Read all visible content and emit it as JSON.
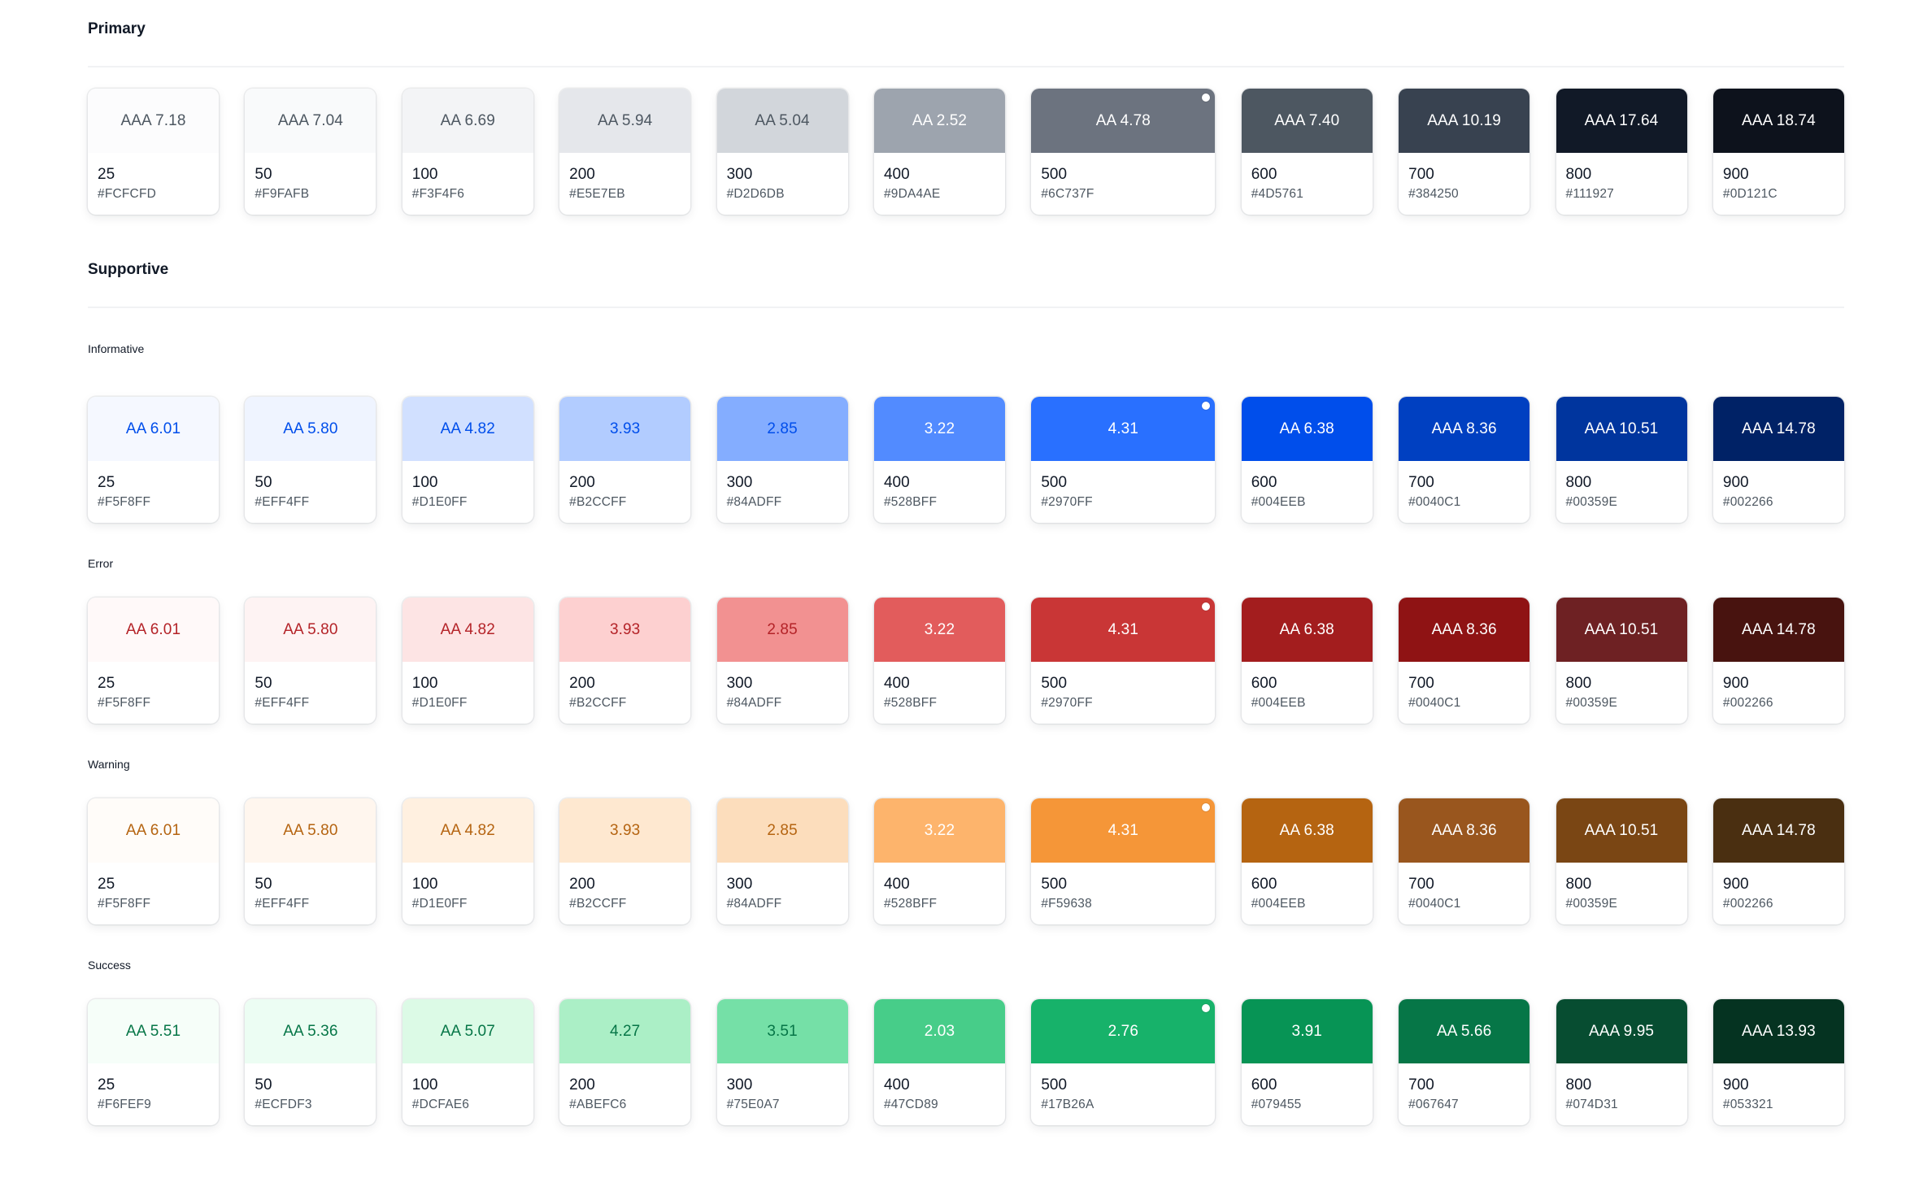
{
  "sections": {
    "primary": {
      "title": "Primary",
      "swatches": [
        {
          "step": "25",
          "hex": "#FCFCFD",
          "label": "AAA 7.18",
          "bg": "#FCFCFD",
          "fg": "#4D5761"
        },
        {
          "step": "50",
          "hex": "#F9FAFB",
          "label": "AAA 7.04",
          "bg": "#F9FAFB",
          "fg": "#4D5761"
        },
        {
          "step": "100",
          "hex": "#F3F4F6",
          "label": "AA 6.69",
          "bg": "#F3F4F6",
          "fg": "#4D5761"
        },
        {
          "step": "200",
          "hex": "#E5E7EB",
          "label": "AA 5.94",
          "bg": "#E5E7EB",
          "fg": "#4D5761"
        },
        {
          "step": "300",
          "hex": "#D2D6DB",
          "label": "AA 5.04",
          "bg": "#D2D6DB",
          "fg": "#4D5761"
        },
        {
          "step": "400",
          "hex": "#9DA4AE",
          "label": "AA 2.52",
          "bg": "#9DA4AE",
          "fg": "#FFFFFF"
        },
        {
          "step": "500",
          "hex": "#6C737F",
          "label": "AA 4.78",
          "bg": "#6C737F",
          "fg": "#FFFFFF",
          "selected": true
        },
        {
          "step": "600",
          "hex": "#4D5761",
          "label": "AAA 7.40",
          "bg": "#4D5761",
          "fg": "#FFFFFF"
        },
        {
          "step": "700",
          "hex": "#384250",
          "label": "AAA 10.19",
          "bg": "#384250",
          "fg": "#FFFFFF"
        },
        {
          "step": "800",
          "hex": "#111927",
          "label": "AAA 17.64",
          "bg": "#111927",
          "fg": "#FFFFFF"
        },
        {
          "step": "900",
          "hex": "#0D121C",
          "label": "AAA 18.74",
          "bg": "#0D121C",
          "fg": "#FFFFFF"
        }
      ]
    },
    "supportive": {
      "title": "Supportive",
      "groups": {
        "informative": {
          "label": "Informative",
          "swatches": [
            {
              "step": "25",
              "hex": "#F5F8FF",
              "label": "AA 6.01",
              "bg": "#F5F8FF",
              "fg": "#004EEB"
            },
            {
              "step": "50",
              "hex": "#EFF4FF",
              "label": "AA 5.80",
              "bg": "#EFF4FF",
              "fg": "#004EEB"
            },
            {
              "step": "100",
              "hex": "#D1E0FF",
              "label": "AA 4.82",
              "bg": "#D1E0FF",
              "fg": "#004EEB"
            },
            {
              "step": "200",
              "hex": "#B2CCFF",
              "label": "3.93",
              "bg": "#B2CCFF",
              "fg": "#004EEB"
            },
            {
              "step": "300",
              "hex": "#84ADFF",
              "label": "2.85",
              "bg": "#84ADFF",
              "fg": "#004EEB"
            },
            {
              "step": "400",
              "hex": "#528BFF",
              "label": "3.22",
              "bg": "#528BFF",
              "fg": "#FFFFFF"
            },
            {
              "step": "500",
              "hex": "#2970FF",
              "label": "4.31",
              "bg": "#2970FF",
              "fg": "#FFFFFF",
              "selected": true
            },
            {
              "step": "600",
              "hex": "#004EEB",
              "label": "AA 6.38",
              "bg": "#004EEB",
              "fg": "#FFFFFF"
            },
            {
              "step": "700",
              "hex": "#0040C1",
              "label": "AAA 8.36",
              "bg": "#0040C1",
              "fg": "#FFFFFF"
            },
            {
              "step": "800",
              "hex": "#00359E",
              "label": "AAA 10.51",
              "bg": "#00359E",
              "fg": "#FFFFFF"
            },
            {
              "step": "900",
              "hex": "#002266",
              "label": "AAA 14.78",
              "bg": "#002266",
              "fg": "#FFFFFF"
            }
          ]
        },
        "error": {
          "label": "Error",
          "swatches": [
            {
              "step": "25",
              "hex": "#F5F8FF",
              "label": "AA 6.01",
              "bg": "#FFF9F9",
              "fg": "#B42328"
            },
            {
              "step": "50",
              "hex": "#EFF4FF",
              "label": "AA 5.80",
              "bg": "#FEF3F3",
              "fg": "#B42328"
            },
            {
              "step": "100",
              "hex": "#D1E0FF",
              "label": "AA 4.82",
              "bg": "#FDE4E4",
              "fg": "#B42328"
            },
            {
              "step": "200",
              "hex": "#B2CCFF",
              "label": "3.93",
              "bg": "#FDD0D0",
              "fg": "#B42328"
            },
            {
              "step": "300",
              "hex": "#84ADFF",
              "label": "2.85",
              "bg": "#F29191",
              "fg": "#B42328"
            },
            {
              "step": "400",
              "hex": "#528BFF",
              "label": "3.22",
              "bg": "#E25C5C",
              "fg": "#FFFFFF"
            },
            {
              "step": "500",
              "hex": "#2970FF",
              "label": "4.31",
              "bg": "#C93636",
              "fg": "#FFFFFF",
              "selected": true
            },
            {
              "step": "600",
              "hex": "#004EEB",
              "label": "AA 6.38",
              "bg": "#A31D1E",
              "fg": "#FFFFFF"
            },
            {
              "step": "700",
              "hex": "#0040C1",
              "label": "AAA 8.36",
              "bg": "#8F1314",
              "fg": "#FFFFFF"
            },
            {
              "step": "800",
              "hex": "#00359E",
              "label": "AAA 10.51",
              "bg": "#6E2123",
              "fg": "#FFFFFF"
            },
            {
              "step": "900",
              "hex": "#002266",
              "label": "AAA 14.78",
              "bg": "#48130F",
              "fg": "#FFFFFF"
            }
          ]
        },
        "warning": {
          "label": "Warning",
          "swatches": [
            {
              "step": "25",
              "hex": "#F5F8FF",
              "label": "AA 6.01",
              "bg": "#FFFCF9",
              "fg": "#B56411"
            },
            {
              "step": "50",
              "hex": "#EFF4FF",
              "label": "AA 5.80",
              "bg": "#FFF6EE",
              "fg": "#B56411"
            },
            {
              "step": "100",
              "hex": "#D1E0FF",
              "label": "AA 4.82",
              "bg": "#FFF0E0",
              "fg": "#B56411"
            },
            {
              "step": "200",
              "hex": "#B2CCFF",
              "label": "3.93",
              "bg": "#FEE8D0",
              "fg": "#B56411"
            },
            {
              "step": "300",
              "hex": "#84ADFF",
              "label": "2.85",
              "bg": "#FCDDBC",
              "fg": "#B56411"
            },
            {
              "step": "400",
              "hex": "#528BFF",
              "label": "3.22",
              "bg": "#FDB46C",
              "fg": "#FFFFFF"
            },
            {
              "step": "500",
              "hex": "#F59638",
              "label": "4.31",
              "bg": "#F59638",
              "fg": "#FFFFFF",
              "selected": true
            },
            {
              "step": "600",
              "hex": "#004EEB",
              "label": "AA 6.38",
              "bg": "#B56411",
              "fg": "#FFFFFF"
            },
            {
              "step": "700",
              "hex": "#0040C1",
              "label": "AAA 8.36",
              "bg": "#99561E",
              "fg": "#FFFFFF"
            },
            {
              "step": "800",
              "hex": "#00359E",
              "label": "AAA 10.51",
              "bg": "#7A4614",
              "fg": "#FFFFFF"
            },
            {
              "step": "900",
              "hex": "#002266",
              "label": "AAA 14.78",
              "bg": "#4A2F11",
              "fg": "#FFFFFF"
            }
          ]
        },
        "success": {
          "label": "Success",
          "swatches": [
            {
              "step": "25",
              "hex": "#F6FEF9",
              "label": "AA 5.51",
              "bg": "#F6FEF9",
              "fg": "#067647"
            },
            {
              "step": "50",
              "hex": "#ECFDF3",
              "label": "AA 5.36",
              "bg": "#ECFDF3",
              "fg": "#067647"
            },
            {
              "step": "100",
              "hex": "#DCFAE6",
              "label": "AA 5.07",
              "bg": "#DCFAE6",
              "fg": "#067647"
            },
            {
              "step": "200",
              "hex": "#ABEFC6",
              "label": "4.27",
              "bg": "#ABEFC6",
              "fg": "#067647"
            },
            {
              "step": "300",
              "hex": "#75E0A7",
              "label": "3.51",
              "bg": "#75E0A7",
              "fg": "#067647"
            },
            {
              "step": "400",
              "hex": "#47CD89",
              "label": "2.03",
              "bg": "#47CD89",
              "fg": "#FFFFFF"
            },
            {
              "step": "500",
              "hex": "#17B26A",
              "label": "2.76",
              "bg": "#17B26A",
              "fg": "#FFFFFF",
              "selected": true
            },
            {
              "step": "600",
              "hex": "#079455",
              "label": "3.91",
              "bg": "#079455",
              "fg": "#FFFFFF"
            },
            {
              "step": "700",
              "hex": "#067647",
              "label": "AA 5.66",
              "bg": "#067647",
              "fg": "#FFFFFF"
            },
            {
              "step": "800",
              "hex": "#074D31",
              "label": "AAA 9.95",
              "bg": "#074D31",
              "fg": "#FFFFFF"
            },
            {
              "step": "900",
              "hex": "#053321",
              "label": "AAA 13.93",
              "bg": "#053321",
              "fg": "#FFFFFF"
            }
          ]
        }
      }
    }
  }
}
